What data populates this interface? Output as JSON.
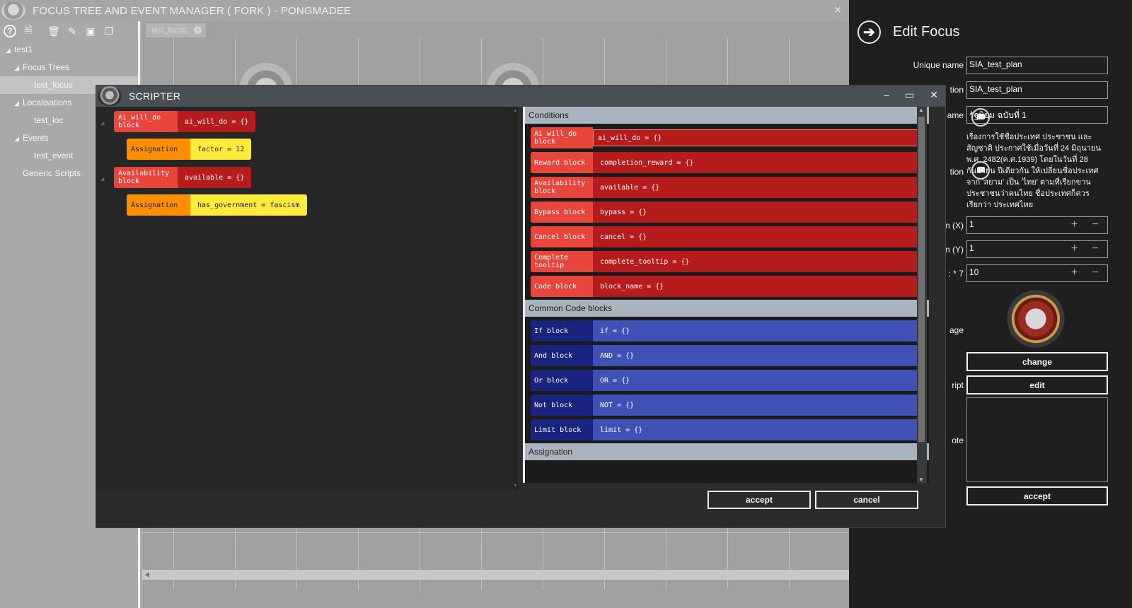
{
  "app": {
    "title": "FOCUS TREE AND EVENT MANAGER ( FORK ) - PONGMADEE",
    "close_glyph": "✕"
  },
  "toolbar": {
    "help": "?",
    "new": "🗎",
    "delete": "🗑",
    "edit": "✎",
    "rename": "▣",
    "copy": "❐"
  },
  "tree": {
    "root": "test1",
    "focus_trees": "Focus Trees",
    "focus_item": "test_focus",
    "localisations": "Localisations",
    "loc_item": "test_loc",
    "events": "Events",
    "event_item": "test_event",
    "generic": "Generic Scripts"
  },
  "canvas": {
    "tab_label": "test_focus",
    "tab_close": "×"
  },
  "edit": {
    "back_glyph": "➔",
    "title": "Edit Focus",
    "unique_name_label": "Unique name",
    "unique_name_value": "SIA_test_plan",
    "loc_label": "tion",
    "loc_value": "SIA_test_plan",
    "name_label": "ame",
    "name_value": "รัฐนิยม ฉบับที่ 1",
    "desc_label": "tion",
    "desc_value": "เรื่องการใช้ชื่อประเทศ ประชาชน และสัญชาติ ประกาศใช้เมื่อวันที่ 24 มิถุนายน พ.ศ. 2482(ค.ศ.1939) โดยในวันที่ 28 กันยายน ปีเดียวกัน ให้เปลี่ยนชื่อประเทศจาก 'สยาม' เป็น 'ไทย' ตามที่เรียกขานประชาชนว่าคนไทย ชื่อประเทศก็ควรเรียกว่า ประเทศไทย",
    "x_label": "n (X)",
    "x_value": "1",
    "y_label": "n (Y)",
    "y_value": "1",
    "cost_label": ": * 7",
    "cost_value": "10",
    "stepper": "+ −",
    "image_label": "age",
    "change_label": "change",
    "script_label": "ript",
    "edit_label": "edit",
    "note_label": "ote",
    "accept_label": "accept"
  },
  "scripter": {
    "title": "SCRIPTER",
    "minimize": "–",
    "maximize": "▭",
    "close": "✕",
    "workspace": [
      {
        "key": "Ai_will_do block",
        "code": "ai_will_do = {}"
      },
      {
        "key": "Assignation",
        "code": "factor = 12"
      },
      {
        "key": "Availability block",
        "code": "available = {}"
      },
      {
        "key": "Assignation",
        "code": "has_government = fascism"
      }
    ],
    "conditions_header": "Conditions",
    "conditions": [
      {
        "key": "Ai_will_do block",
        "code": "ai_will_do = {}"
      },
      {
        "key": "Reward block",
        "code": "completion_reward = {}"
      },
      {
        "key": "Availability block",
        "code": "available = {}"
      },
      {
        "key": "Bypass block",
        "code": "bypass = {}"
      },
      {
        "key": "Cancel block",
        "code": "cancel = {}"
      },
      {
        "key": "Complete tooltip",
        "code": "complete_tooltip = {}"
      },
      {
        "key": "Code block",
        "code": "block_name = {}"
      }
    ],
    "common_header": "Common Code blocks",
    "common": [
      {
        "key": "If block",
        "code": "if = {}"
      },
      {
        "key": "And block",
        "code": "AND = {}"
      },
      {
        "key": "Or block",
        "code": "OR = {}"
      },
      {
        "key": "Not block",
        "code": "NOT = {}"
      },
      {
        "key": "Limit block",
        "code": "limit = {}"
      }
    ],
    "next_header": "Assignation",
    "accept_label": "accept",
    "cancel_label": "cancel"
  },
  "colors": {
    "condition_key": "#e8453c",
    "condition_value": "#b71c1c",
    "assign_key": "#ff8f00",
    "assign_value": "#ffeb3b",
    "common_key": "#1a237e",
    "common_value": "#3f51b5"
  }
}
